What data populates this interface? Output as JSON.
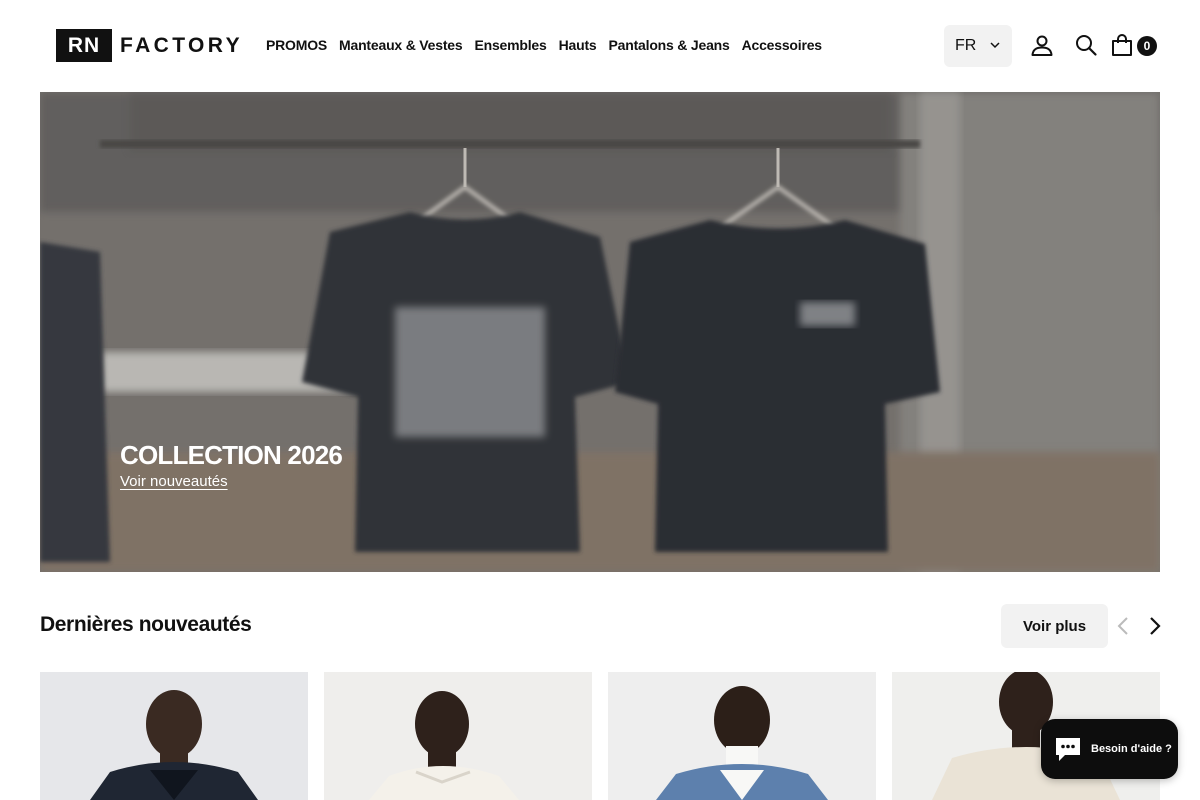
{
  "brand": {
    "logo_mark": "RN",
    "logo_text": "FACTORY"
  },
  "nav": [
    {
      "label": "PROMOS"
    },
    {
      "label": "Manteaux & Vestes"
    },
    {
      "label": "Ensembles"
    },
    {
      "label": "Hauts"
    },
    {
      "label": "Pantalons & Jeans"
    },
    {
      "label": "Accessoires"
    }
  ],
  "header": {
    "language": "FR",
    "cart_count": "0",
    "icons": [
      "account-icon",
      "search-icon",
      "cart-icon",
      "chevron-down-icon"
    ]
  },
  "hero": {
    "title": "COLLECTION 2026",
    "link": "Voir nouveautés"
  },
  "section": {
    "title": "Dernières nouveautés",
    "button": "Voir plus",
    "icons": [
      "arrow-left-icon",
      "arrow-right-icon"
    ]
  },
  "products": [
    {
      "icon": "product-image"
    },
    {
      "icon": "product-image"
    },
    {
      "icon": "product-image"
    },
    {
      "icon": "product-image"
    }
  ],
  "chat": {
    "label": "Besoin d'aide ?",
    "icon": "chat-icon"
  },
  "colors": {
    "accent": "#111111",
    "panel": "#f2f2f2",
    "chat_bg": "#0d0d0d"
  }
}
